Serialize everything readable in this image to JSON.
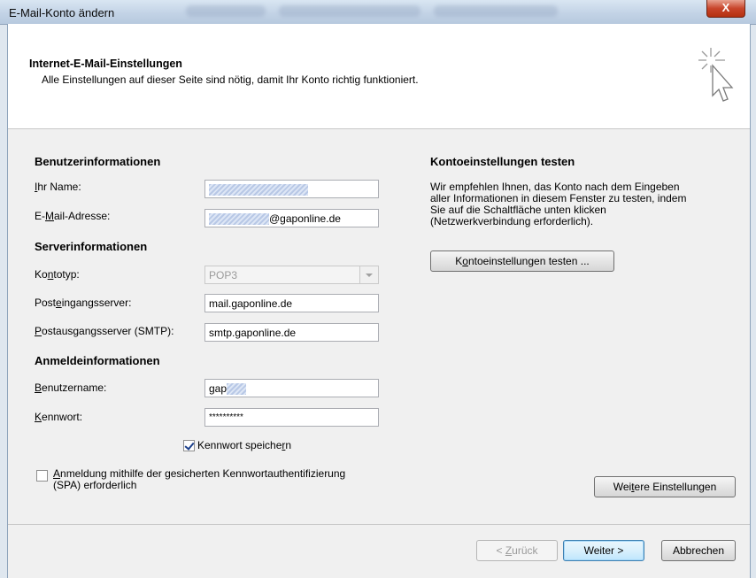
{
  "window": {
    "title": "E-Mail-Konto ändern",
    "close_glyph": "X"
  },
  "header": {
    "title": "Internet-E-Mail-Einstellungen",
    "subtitle": "Alle Einstellungen auf dieser Seite sind nötig, damit Ihr Konto richtig funktioniert.",
    "icon": "sparkle-cursor-icon"
  },
  "user_info": {
    "section_title": "Benutzerinformationen",
    "name_label_u": "I",
    "name_label_rest": "hr Name:",
    "email_label_pre": "E-",
    "email_label_u": "M",
    "email_label_rest": "ail-Adresse:",
    "email_value_domain": "@gaponline.de"
  },
  "server_info": {
    "section_title": "Serverinformationen",
    "account_type_label_pre": "Ko",
    "account_type_label_u": "n",
    "account_type_label_rest": "totyp:",
    "account_type_value": "POP3",
    "incoming_label_pre": "Post",
    "incoming_label_u": "e",
    "incoming_label_rest": "ingangsserver:",
    "incoming_value": "mail.gaponline.de",
    "outgoing_label_u": "P",
    "outgoing_label_rest": "ostausgangsserver (SMTP):",
    "outgoing_value": "smtp.gaponline.de"
  },
  "login_info": {
    "section_title": "Anmeldeinformationen",
    "username_label_u": "B",
    "username_label_rest": "enutzername:",
    "username_value_visible": "gap",
    "password_label_u": "K",
    "password_label_rest": "ennwort:",
    "password_value": "**********",
    "save_password_pre": "Kennwort speiche",
    "save_password_u": "r",
    "save_password_rest": "n",
    "save_password_checked": true,
    "spa_line1_u": "A",
    "spa_line1_rest": "nmeldung mithilfe der gesicherten Kennwortauthentifizierung",
    "spa_line2": "(SPA) erforderlich",
    "spa_checked": false
  },
  "test_section": {
    "section_title": "Kontoeinstellungen testen",
    "description_lines": [
      "Wir empfehlen Ihnen, das Konto nach dem Eingeben",
      "aller Informationen in diesem Fenster zu testen, indem",
      "Sie auf die Schaltfläche unten klicken",
      "(Netzwerkverbindung erforderlich)."
    ],
    "test_button_pre": "K",
    "test_button_u": "o",
    "test_button_rest": "ntoeinstellungen testen ...",
    "more_settings_pre": "Wei",
    "more_settings_u": "t",
    "more_settings_rest": "ere Einstellungen"
  },
  "footer": {
    "back_pre": "< ",
    "back_u": "Z",
    "back_rest": "urück",
    "next_label": "Weiter >",
    "cancel_label": "Abbrechen"
  }
}
